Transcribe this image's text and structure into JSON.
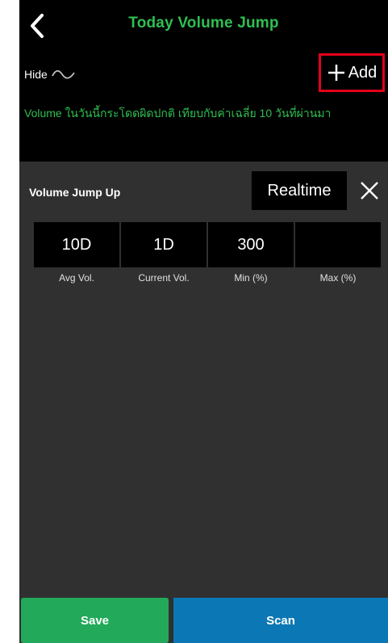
{
  "header": {
    "title": "Today Volume Jump",
    "back_icon": "chevron-left-icon",
    "hide_label": "Hide",
    "hide_icon": "wave-icon",
    "add_label": "Add",
    "add_icon": "plus-icon",
    "description": "Volume ในวันนี้กระโดดผิดปกติ เทียบกับค่าเฉลี่ย 10 วันที่ผ่านมา"
  },
  "condition": {
    "label": "Volume Jump Up",
    "mode": "Realtime",
    "close_icon": "close-icon",
    "values": [
      "10D",
      "1D",
      "300",
      ""
    ],
    "labels": [
      "Avg Vol.",
      "Current Vol.",
      "Min (%)",
      "Max (%)"
    ]
  },
  "footer": {
    "save_label": "Save",
    "scan_label": "Scan"
  },
  "colors": {
    "accent_green": "#2fbf52",
    "save_green": "#22a95a",
    "scan_blue": "#0b77b4",
    "highlight_red": "#e4001b",
    "panel_bg": "#303030",
    "header_bg": "#000000"
  }
}
